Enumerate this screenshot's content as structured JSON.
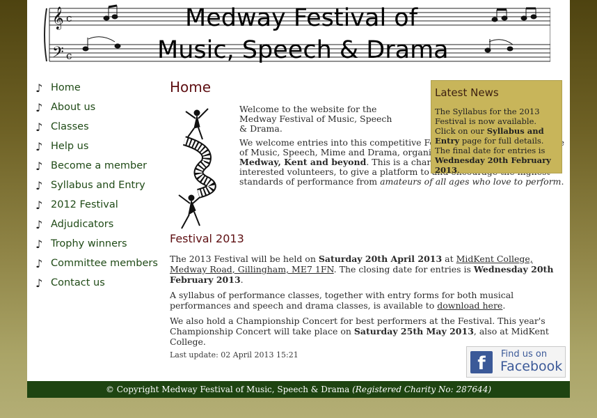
{
  "header": {
    "title_line1": "Medway Festival of",
    "title_line2": "Music, Speech & Drama"
  },
  "nav": {
    "icon": "music-note-icon",
    "items": [
      {
        "label": "Home"
      },
      {
        "label": "About us"
      },
      {
        "label": "Classes"
      },
      {
        "label": "Help us"
      },
      {
        "label": "Become a member"
      },
      {
        "label": "Syllabus and Entry"
      },
      {
        "label": "2012 Festival"
      },
      {
        "label": "Adjudicators"
      },
      {
        "label": "Trophy winners"
      },
      {
        "label": "Committee members"
      },
      {
        "label": "Contact us"
      }
    ]
  },
  "main": {
    "heading": "Home",
    "intro1": "Welcome to the website for the Medway Festival of Music, Speech & Drama.",
    "intro2_a": "We welcome entries into this competitive Festival covering a broad range of Music, Speech, Mime and Drama, organised for ",
    "intro2_b": "all residents of Medway, Kent and beyond",
    "intro2_c": ". This is a charitable organisation, run by interested volunteers, to give a platform to and encourage the highest standards of performance from ",
    "intro2_d": "amateurs of all ages who love to perform",
    "intro2_e": "."
  },
  "news": {
    "heading": "Latest News",
    "t1": "The Syllabus for the 2013 Festival is now available. Click on our ",
    "t2": "Syllabus and Entry",
    "t3": " page for full details. The final date for entries is ",
    "t4": "Wednesday 20th February 2013",
    "t5": "."
  },
  "festival": {
    "heading": "Festival 2013",
    "p1_a": "The 2013 Festival will be held on ",
    "p1_b": "Saturday 20th April 2013",
    "p1_c": " at ",
    "p1_link": "MidKent College, Medway Road, Gillingham, ME7 1FN",
    "p1_d": ".  The closing date for entries is ",
    "p1_e": "Wednesday 20th February 2013",
    "p1_f": ".",
    "p2_a": "A syllabus of performance classes, together with entry forms for both musical performances and speech and drama classes, is available to ",
    "p2_link": "download here",
    "p2_b": ".",
    "p3_a": "We also hold a Championship Concert for best performers at the Festival. This year's Championship Concert will take place on ",
    "p3_b": "Saturday 25th May 2013",
    "p3_c": ", also at MidKent College."
  },
  "last_update": "Last update: 02 April 2013 15:21",
  "facebook": {
    "line1": "Find us on",
    "line2": "Facebook",
    "logo": "f",
    "color": "#3b5998"
  },
  "footer": {
    "text": "© Copyright Medway Festival of Music, Speech & Drama ",
    "italic": "(Registered Charity No: 287644)"
  },
  "colors": {
    "nav_text": "#1f4a16",
    "heading": "#5e0f12",
    "news_bg": "#c8b55a",
    "footer_bg": "#1e4411"
  }
}
